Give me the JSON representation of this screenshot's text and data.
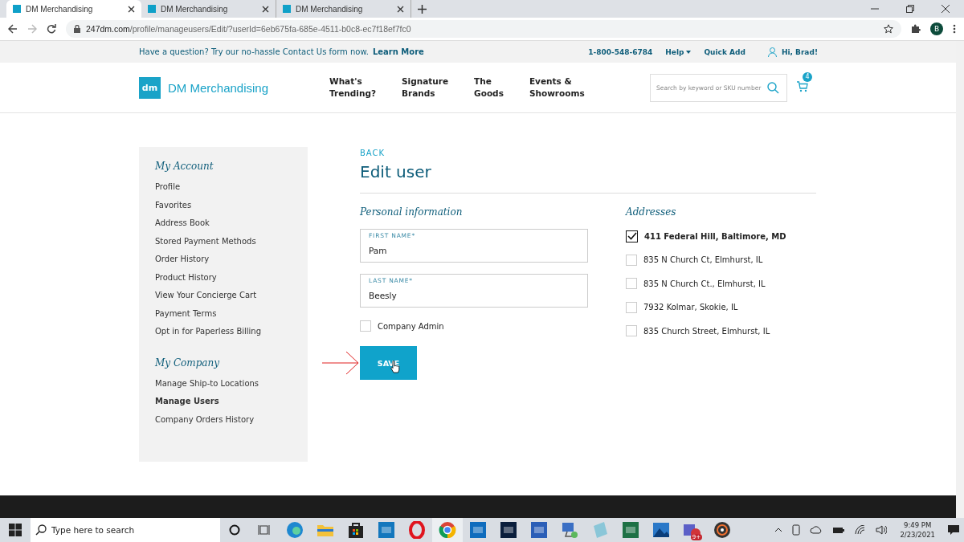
{
  "browser": {
    "tabs": [
      {
        "title": "DM Merchandising",
        "selected": true
      },
      {
        "title": "DM Merchandising",
        "selected": false
      },
      {
        "title": "DM Merchandising",
        "selected": false
      }
    ],
    "url_host": "247dm.com",
    "url_path": "/profile/manageusers/Edit/?userId=6eb675fa-685e-4511-b0c8-ec7f18ef7fc0",
    "profile_initial": "B"
  },
  "promo_bar": {
    "message": "Have a question? Try our no-hassle Contact Us form now.",
    "link": "Learn More",
    "phone": "1-800-548-6784",
    "help": "Help",
    "quick_add": "Quick Add",
    "greeting": "Hi, Brad!"
  },
  "header": {
    "logo_mark": "dm",
    "logo_text": "DM Merchandising",
    "nav": [
      [
        "What's",
        "Trending?"
      ],
      [
        "Signature",
        "Brands"
      ],
      [
        "The",
        "Goods"
      ],
      [
        "Events &",
        "Showrooms"
      ]
    ],
    "search_placeholder": "Search by keyword or SKU number",
    "cart_count": "4"
  },
  "sidebar": {
    "sections": [
      {
        "title": "My Account",
        "items": [
          {
            "label": "Profile",
            "selected": false
          },
          {
            "label": "Favorites",
            "selected": false
          },
          {
            "label": "Address Book",
            "selected": false
          },
          {
            "label": "Stored Payment Methods",
            "selected": false
          },
          {
            "label": "Order History",
            "selected": false
          },
          {
            "label": "Product History",
            "selected": false
          },
          {
            "label": "View Your Concierge Cart",
            "selected": false
          },
          {
            "label": "Payment Terms",
            "selected": false
          },
          {
            "label": "Opt in for Paperless Billing",
            "selected": false
          }
        ]
      },
      {
        "title": "My Company",
        "items": [
          {
            "label": "Manage Ship-to Locations",
            "selected": false
          },
          {
            "label": "Manage Users",
            "selected": true
          },
          {
            "label": "Company Orders History",
            "selected": false
          }
        ]
      }
    ]
  },
  "form": {
    "back": "BACK",
    "title": "Edit user",
    "personal_heading": "Personal information",
    "fields": [
      {
        "label": "FIRST NAME*",
        "value": "Pam"
      },
      {
        "label": "LAST NAME*",
        "value": "Beesly"
      }
    ],
    "company_admin": {
      "label": "Company Admin",
      "checked": false
    },
    "save": "SAVE",
    "addresses_heading": "Addresses",
    "addresses": [
      {
        "label": "411 Federal Hill, Baltimore, MD",
        "checked": true
      },
      {
        "label": "835 N Church Ct, Elmhurst, IL",
        "checked": false
      },
      {
        "label": "835 N Church Ct., Elmhurst, IL",
        "checked": false
      },
      {
        "label": "7932 Kolmar, Skokie, IL",
        "checked": false
      },
      {
        "label": "835 Church Street, Elmhurst, IL",
        "checked": false
      }
    ]
  },
  "taskbar": {
    "search_placeholder": "Type here to search",
    "time": "9:49 PM",
    "date": "2/23/2021",
    "teams_badge": "9+"
  }
}
